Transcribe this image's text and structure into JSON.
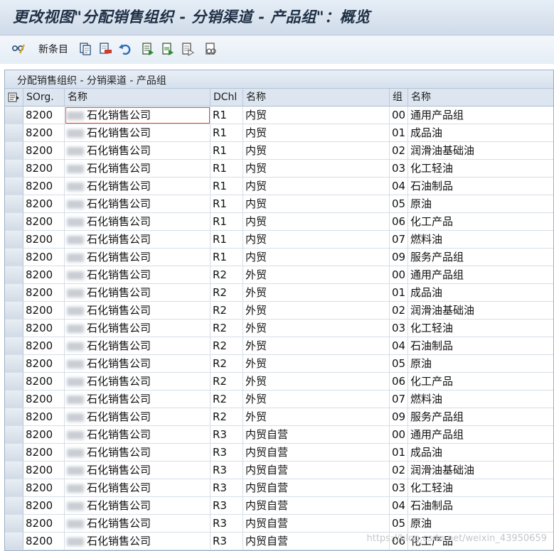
{
  "window": {
    "title": "更改视图\"分配销售组织 - 分销渠道 - 产品组\"：概览"
  },
  "toolbar": {
    "new_entries_label": "新条目",
    "icons": [
      "glasses-edit-icon",
      "copy-icon",
      "delete-icon",
      "undo-icon",
      "select-all-icon",
      "select-block-icon",
      "deselect-all-icon",
      "print-preview-icon"
    ]
  },
  "panel": {
    "title": "分配销售组织 - 分销渠道 - 产品组"
  },
  "table": {
    "headers": {
      "sorg": "SOrg.",
      "sorg_name": "名称",
      "dchl": "DChl",
      "dchl_name": "名称",
      "div": "组",
      "div_name": "名称"
    },
    "rows": [
      {
        "sorg": "8200",
        "sorg_name": "石化销售公司",
        "dchl": "R1",
        "dchl_name": "内贸",
        "div": "00",
        "div_name": "通用产品组"
      },
      {
        "sorg": "8200",
        "sorg_name": "石化销售公司",
        "dchl": "R1",
        "dchl_name": "内贸",
        "div": "01",
        "div_name": "成品油"
      },
      {
        "sorg": "8200",
        "sorg_name": "石化销售公司",
        "dchl": "R1",
        "dchl_name": "内贸",
        "div": "02",
        "div_name": "润滑油基础油"
      },
      {
        "sorg": "8200",
        "sorg_name": "石化销售公司",
        "dchl": "R1",
        "dchl_name": "内贸",
        "div": "03",
        "div_name": "化工轻油"
      },
      {
        "sorg": "8200",
        "sorg_name": "石化销售公司",
        "dchl": "R1",
        "dchl_name": "内贸",
        "div": "04",
        "div_name": "石油制品"
      },
      {
        "sorg": "8200",
        "sorg_name": "石化销售公司",
        "dchl": "R1",
        "dchl_name": "内贸",
        "div": "05",
        "div_name": "原油"
      },
      {
        "sorg": "8200",
        "sorg_name": "石化销售公司",
        "dchl": "R1",
        "dchl_name": "内贸",
        "div": "06",
        "div_name": "化工产品"
      },
      {
        "sorg": "8200",
        "sorg_name": "石化销售公司",
        "dchl": "R1",
        "dchl_name": "内贸",
        "div": "07",
        "div_name": "燃料油"
      },
      {
        "sorg": "8200",
        "sorg_name": "石化销售公司",
        "dchl": "R1",
        "dchl_name": "内贸",
        "div": "09",
        "div_name": "服务产品组"
      },
      {
        "sorg": "8200",
        "sorg_name": "石化销售公司",
        "dchl": "R2",
        "dchl_name": "外贸",
        "div": "00",
        "div_name": "通用产品组"
      },
      {
        "sorg": "8200",
        "sorg_name": "石化销售公司",
        "dchl": "R2",
        "dchl_name": "外贸",
        "div": "01",
        "div_name": "成品油"
      },
      {
        "sorg": "8200",
        "sorg_name": "石化销售公司",
        "dchl": "R2",
        "dchl_name": "外贸",
        "div": "02",
        "div_name": "润滑油基础油"
      },
      {
        "sorg": "8200",
        "sorg_name": "石化销售公司",
        "dchl": "R2",
        "dchl_name": "外贸",
        "div": "03",
        "div_name": "化工轻油"
      },
      {
        "sorg": "8200",
        "sorg_name": "石化销售公司",
        "dchl": "R2",
        "dchl_name": "外贸",
        "div": "04",
        "div_name": "石油制品"
      },
      {
        "sorg": "8200",
        "sorg_name": "石化销售公司",
        "dchl": "R2",
        "dchl_name": "外贸",
        "div": "05",
        "div_name": "原油"
      },
      {
        "sorg": "8200",
        "sorg_name": "石化销售公司",
        "dchl": "R2",
        "dchl_name": "外贸",
        "div": "06",
        "div_name": "化工产品"
      },
      {
        "sorg": "8200",
        "sorg_name": "石化销售公司",
        "dchl": "R2",
        "dchl_name": "外贸",
        "div": "07",
        "div_name": "燃料油"
      },
      {
        "sorg": "8200",
        "sorg_name": "石化销售公司",
        "dchl": "R2",
        "dchl_name": "外贸",
        "div": "09",
        "div_name": "服务产品组"
      },
      {
        "sorg": "8200",
        "sorg_name": "石化销售公司",
        "dchl": "R3",
        "dchl_name": "内贸自营",
        "div": "00",
        "div_name": "通用产品组"
      },
      {
        "sorg": "8200",
        "sorg_name": "石化销售公司",
        "dchl": "R3",
        "dchl_name": "内贸自营",
        "div": "01",
        "div_name": "成品油"
      },
      {
        "sorg": "8200",
        "sorg_name": "石化销售公司",
        "dchl": "R3",
        "dchl_name": "内贸自营",
        "div": "02",
        "div_name": "润滑油基础油"
      },
      {
        "sorg": "8200",
        "sorg_name": "石化销售公司",
        "dchl": "R3",
        "dchl_name": "内贸自营",
        "div": "03",
        "div_name": "化工轻油"
      },
      {
        "sorg": "8200",
        "sorg_name": "石化销售公司",
        "dchl": "R3",
        "dchl_name": "内贸自营",
        "div": "04",
        "div_name": "石油制品"
      },
      {
        "sorg": "8200",
        "sorg_name": "石化销售公司",
        "dchl": "R3",
        "dchl_name": "内贸自营",
        "div": "05",
        "div_name": "原油"
      },
      {
        "sorg": "8200",
        "sorg_name": "石化销售公司",
        "dchl": "R3",
        "dchl_name": "内贸自营",
        "div": "06",
        "div_name": "化工产品"
      }
    ]
  },
  "watermark": "https://blog.csdn.net/weixin_43950659"
}
